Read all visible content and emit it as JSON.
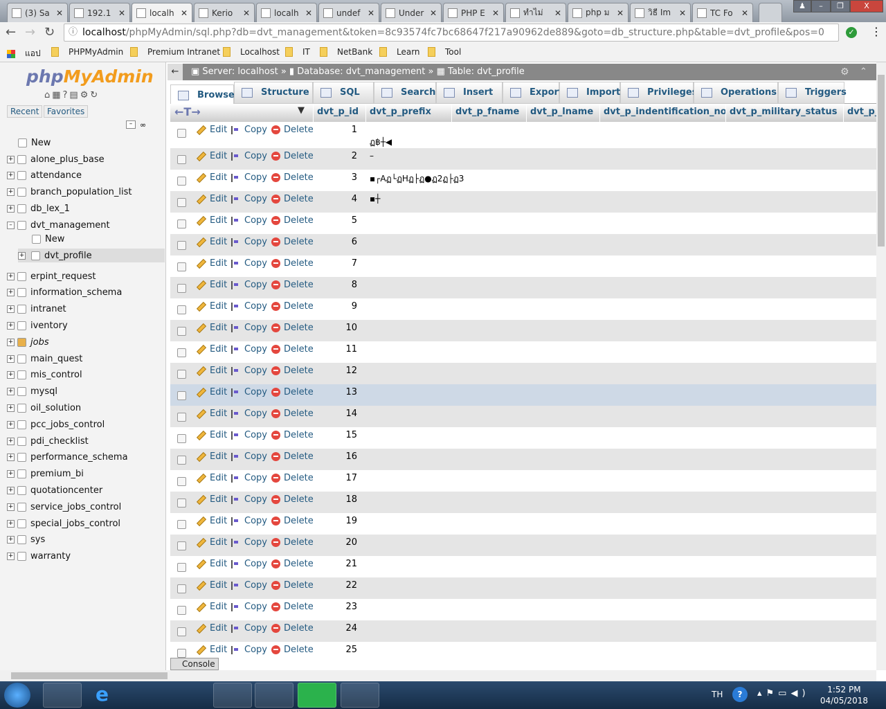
{
  "browser": {
    "tabs": [
      {
        "title": "(3) Sa",
        "icon": "youtube-icon"
      },
      {
        "title": "192.1",
        "icon": "page-icon"
      },
      {
        "title": "localh",
        "icon": "phpmyadmin-icon",
        "active": true
      },
      {
        "title": "Kerio",
        "icon": "kerio-icon"
      },
      {
        "title": "localh",
        "icon": "page-icon"
      },
      {
        "title": "undef",
        "icon": "google-icon"
      },
      {
        "title": "Under",
        "icon": "google-icon"
      },
      {
        "title": "PHP E",
        "icon": "page-icon"
      },
      {
        "title": "ทำไม่",
        "icon": "page-icon"
      },
      {
        "title": "php ม",
        "icon": "google-icon"
      },
      {
        "title": "วิธี Im",
        "icon": "blogger-icon"
      },
      {
        "title": "TC Fo",
        "icon": "page-icon"
      }
    ],
    "url_host": "localhost",
    "url_rest": "/phpMyAdmin/sql.php?db=dvt_management&token=8c93574fc7bc68647f217a90962de889&goto=db_structure.php&table=dvt_profile&pos=0",
    "bookmarks": [
      "แอป",
      "PHPMyAdmin",
      "Premium Intranet",
      "Localhost",
      "IT",
      "NetBank",
      "Learn",
      "Tool"
    ]
  },
  "sidebar": {
    "logo": "phpMyAdmin",
    "recent": "Recent",
    "favorites": "Favorites",
    "new": "New",
    "databases": [
      "alone_plus_base",
      "attendance",
      "branch_population_list",
      "db_lex_1",
      "dvt_management",
      "erpint_request",
      "information_schema",
      "intranet",
      "iventory",
      "jobs",
      "main_quest",
      "mis_control",
      "mysql",
      "oil_solution",
      "pcc_jobs_control",
      "pdi_checklist",
      "performance_schema",
      "premium_bi",
      "quotationcenter",
      "service_jobs_control",
      "special_jobs_control",
      "sys",
      "warranty"
    ],
    "sub_new": "New",
    "sub_table": "dvt_profile"
  },
  "breadcrumb": {
    "server": "Server: localhost",
    "database": "Database: dvt_management",
    "table": "Table: dvt_profile"
  },
  "tabs": [
    "Browse",
    "Structure",
    "SQL",
    "Search",
    "Insert",
    "Export",
    "Import",
    "Privileges",
    "Operations",
    "Triggers"
  ],
  "columns": [
    "dvt_p_id",
    "dvt_p_prefix",
    "dvt_p_fname",
    "dvt_p_lname",
    "dvt_p_indentification_no",
    "dvt_p_military_status",
    "dvt_p_"
  ],
  "actions": {
    "edit": "Edit",
    "copy": "Copy",
    "delete": "Delete"
  },
  "rows": [
    {
      "id": "1",
      "prefix": "ฏ฿┼◀"
    },
    {
      "id": "2",
      "prefix": "–"
    },
    {
      "id": "3",
      "prefix": "▪┌Aฏ└ฏHฏ├ฏ●ฏ2ฏ├ฏ3"
    },
    {
      "id": "4",
      "prefix": "▪┼"
    },
    {
      "id": "5"
    },
    {
      "id": "6"
    },
    {
      "id": "7"
    },
    {
      "id": "8"
    },
    {
      "id": "9"
    },
    {
      "id": "10"
    },
    {
      "id": "11"
    },
    {
      "id": "12"
    },
    {
      "id": "13",
      "highlighted": true
    },
    {
      "id": "14"
    },
    {
      "id": "15"
    },
    {
      "id": "16"
    },
    {
      "id": "17"
    },
    {
      "id": "18"
    },
    {
      "id": "19"
    },
    {
      "id": "20"
    },
    {
      "id": "21"
    },
    {
      "id": "22"
    },
    {
      "id": "23"
    },
    {
      "id": "24"
    },
    {
      "id": "25"
    }
  ],
  "console": "Console",
  "taskbar": {
    "lang": "TH",
    "time": "1:52 PM",
    "date": "04/05/2018"
  }
}
